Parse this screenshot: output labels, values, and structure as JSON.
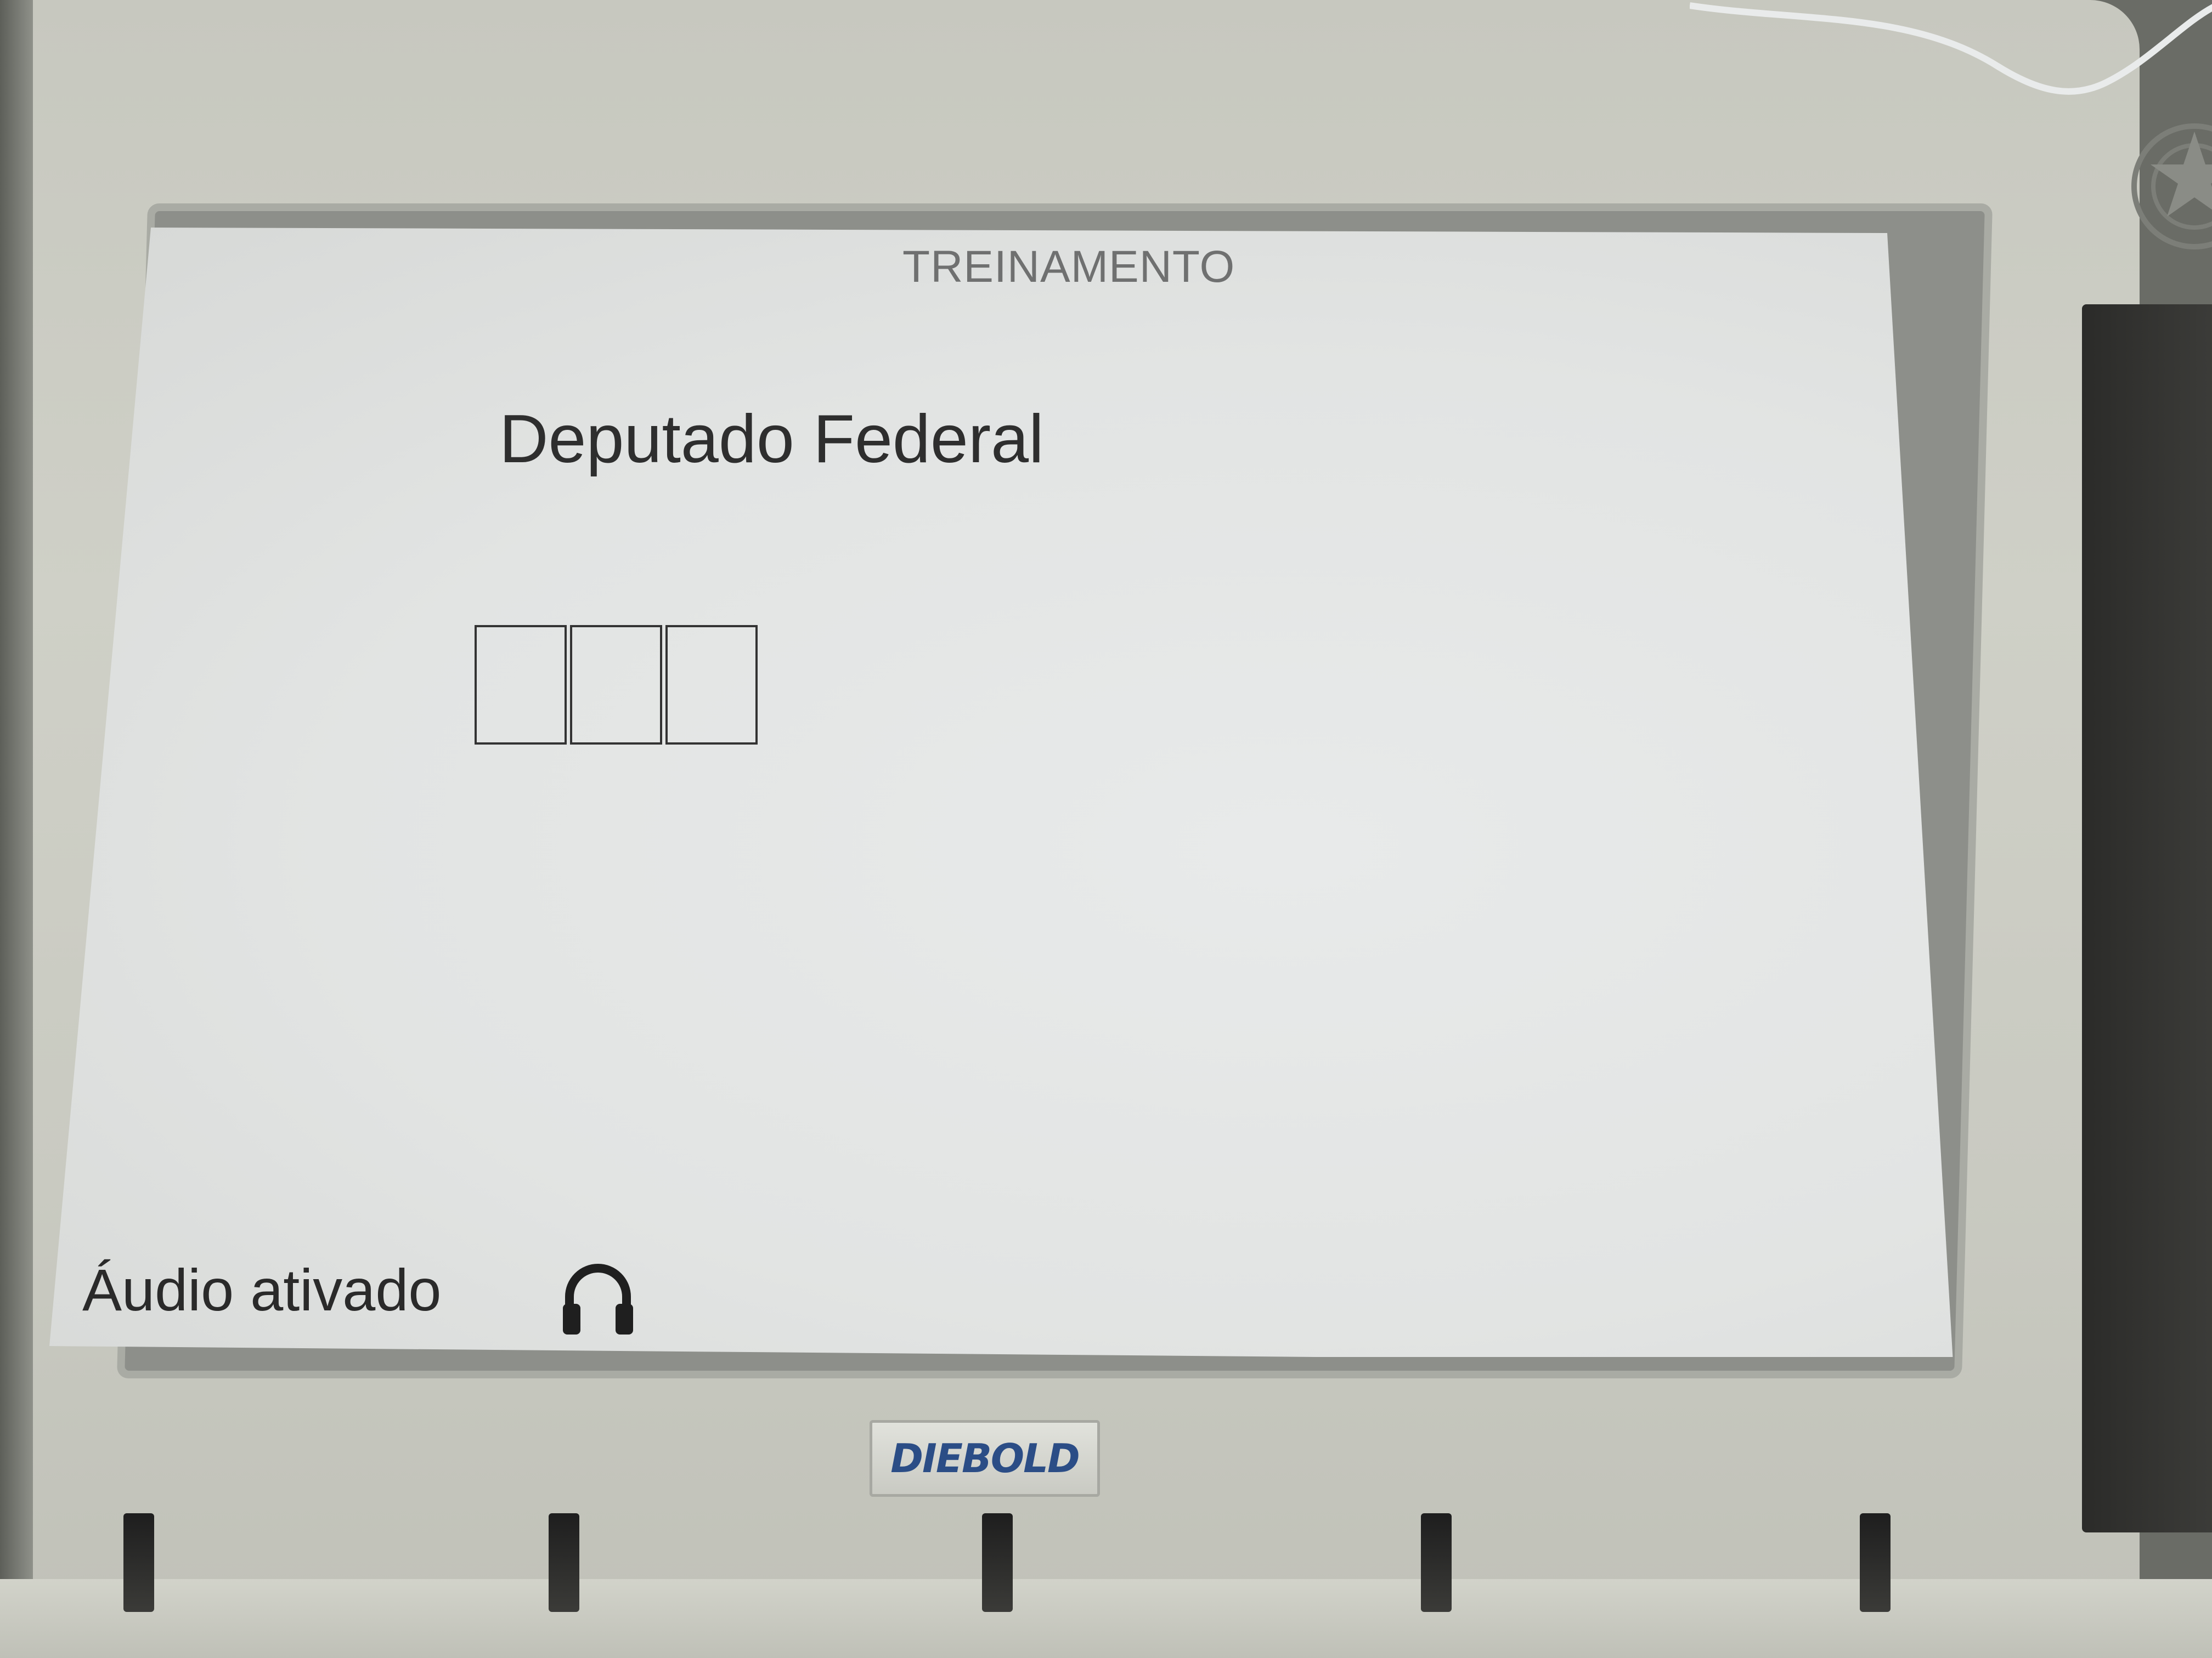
{
  "screen": {
    "header": "TREINAMENTO",
    "office": "Deputado Federal",
    "digit_boxes": [
      "",
      "",
      ""
    ],
    "audio_status": "Áudio ativado",
    "audio_icon": "headphones-icon"
  },
  "device": {
    "brand": "DIEBOLD",
    "brand_color": "#2b4d86",
    "emblem_icon": "coat-of-arms-icon"
  },
  "colors": {
    "screen_background": "#e2e4e3",
    "text": "#2c2c2c"
  }
}
